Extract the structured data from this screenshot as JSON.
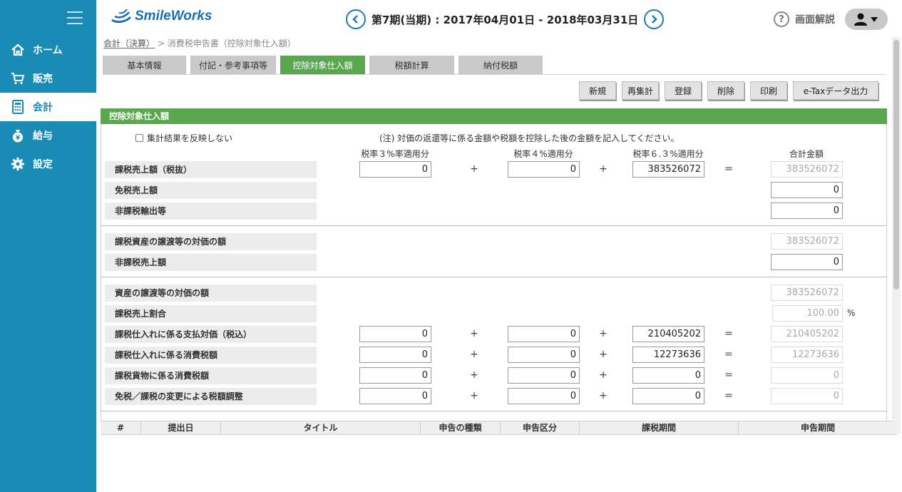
{
  "sidebar": {
    "items": [
      {
        "label": "ホーム",
        "icon": "home-icon"
      },
      {
        "label": "販売",
        "icon": "cart-icon"
      },
      {
        "label": "会計",
        "icon": "calculator-icon",
        "active": true
      },
      {
        "label": "給与",
        "icon": "yen-bag-icon"
      },
      {
        "label": "設定",
        "icon": "gear-icon"
      }
    ]
  },
  "header": {
    "logo": "SmileWorks",
    "period": "第7期(当期) : 2017年04月01日 - 2018年03月31日",
    "help": "画面解説"
  },
  "breadcrumb": {
    "parent": "会計（決算）",
    "separator": ">",
    "current": "消費税申告書（控除対象仕入額）"
  },
  "tabs": [
    "基本情報",
    "付記・参考事項等",
    "控除対象仕入額",
    "税額計算",
    "納付税額"
  ],
  "actions": [
    "新規",
    "再集計",
    "登録",
    "削除",
    "印刷",
    "e-Taxデータ出力"
  ],
  "section": {
    "title": "控除対象仕入額",
    "checkbox_label": "集計結果を反映しない",
    "note": "(注) 対価の返還等に係る金額や税額を控除した後の金額を記入してください。",
    "columns": [
      "税率３%率適用分",
      "税率４%適用分",
      "税率６.３%適用分",
      "合計金額"
    ]
  },
  "rows": {
    "r1": {
      "label": "課税売上額（税抜）",
      "v3": "0",
      "v4": "0",
      "v63": "383526072",
      "total": "383526072"
    },
    "r2": {
      "label": "免税売上額",
      "total": "0"
    },
    "r3": {
      "label": "非課税輸出等",
      "total": "0"
    },
    "r4": {
      "label": "課税資産の譲渡等の対価の額",
      "total": "383526072"
    },
    "r5": {
      "label": "非課税売上額",
      "total": "0"
    },
    "r6": {
      "label": "資産の譲渡等の対価の額",
      "total": "383526072"
    },
    "r7": {
      "label": "課税売上割合",
      "total": "100.00",
      "unit": "%"
    },
    "r8": {
      "label": "課税仕入れに係る支払対価（税込）",
      "v3": "0",
      "v4": "0",
      "v63": "210405202",
      "total": "210405202"
    },
    "r9": {
      "label": "課税仕入れに係る消費税額",
      "v3": "0",
      "v4": "0",
      "v63": "12273636",
      "total": "12273636"
    },
    "r10": {
      "label": "課税貨物に係る消費税額",
      "v3": "0",
      "v4": "0",
      "v63": "0",
      "total": "0"
    },
    "r11": {
      "label": "免税／課税の変更による税額調整",
      "v3": "0",
      "v4": "0",
      "v63": "0",
      "total": "0"
    }
  },
  "operators": {
    "plus": "+",
    "equals": "="
  },
  "table": {
    "headers": [
      "#",
      "提出日",
      "タイトル",
      "申告の種類",
      "申告区分",
      "課税期間",
      "申告期間"
    ]
  }
}
